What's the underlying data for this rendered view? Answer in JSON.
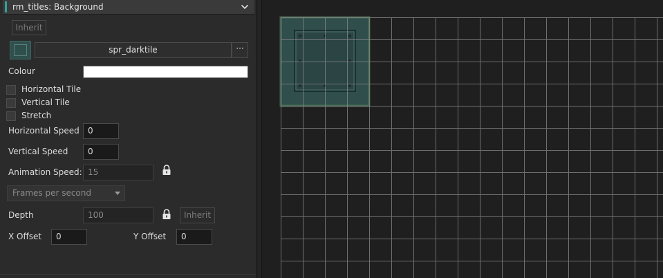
{
  "panel": {
    "title": "rm_titles: Background",
    "inherit_label": "Inherit",
    "sprite_name": "spr_darktile",
    "sprite_more": "···",
    "colour_label": "Colour",
    "colour_value": "#ffffff",
    "horizontal_tile_label": "Horizontal Tile",
    "horizontal_tile_checked": false,
    "vertical_tile_label": "Vertical Tile",
    "vertical_tile_checked": false,
    "stretch_label": "Stretch",
    "stretch_checked": false,
    "horizontal_speed_label": "Horizontal Speed",
    "horizontal_speed_value": "0",
    "vertical_speed_label": "Vertical Speed",
    "vertical_speed_value": "0",
    "animation_speed_label": "Animation Speed:",
    "animation_speed_value": "15",
    "animation_unit": "Frames per second",
    "depth_label": "Depth",
    "depth_value": "100",
    "depth_inherit_label": "Inherit",
    "x_offset_label": "X Offset",
    "x_offset_value": "0",
    "y_offset_label": "Y Offset",
    "y_offset_value": "0"
  },
  "icons": {
    "header": "chevron-down-icon",
    "lock": "lock-icon",
    "dropdown": "dropdown-arrow-icon"
  },
  "colors": {
    "accent": "#2fa39a",
    "grid": "#8a8a8a",
    "tile_base": "#2f4e4c"
  }
}
